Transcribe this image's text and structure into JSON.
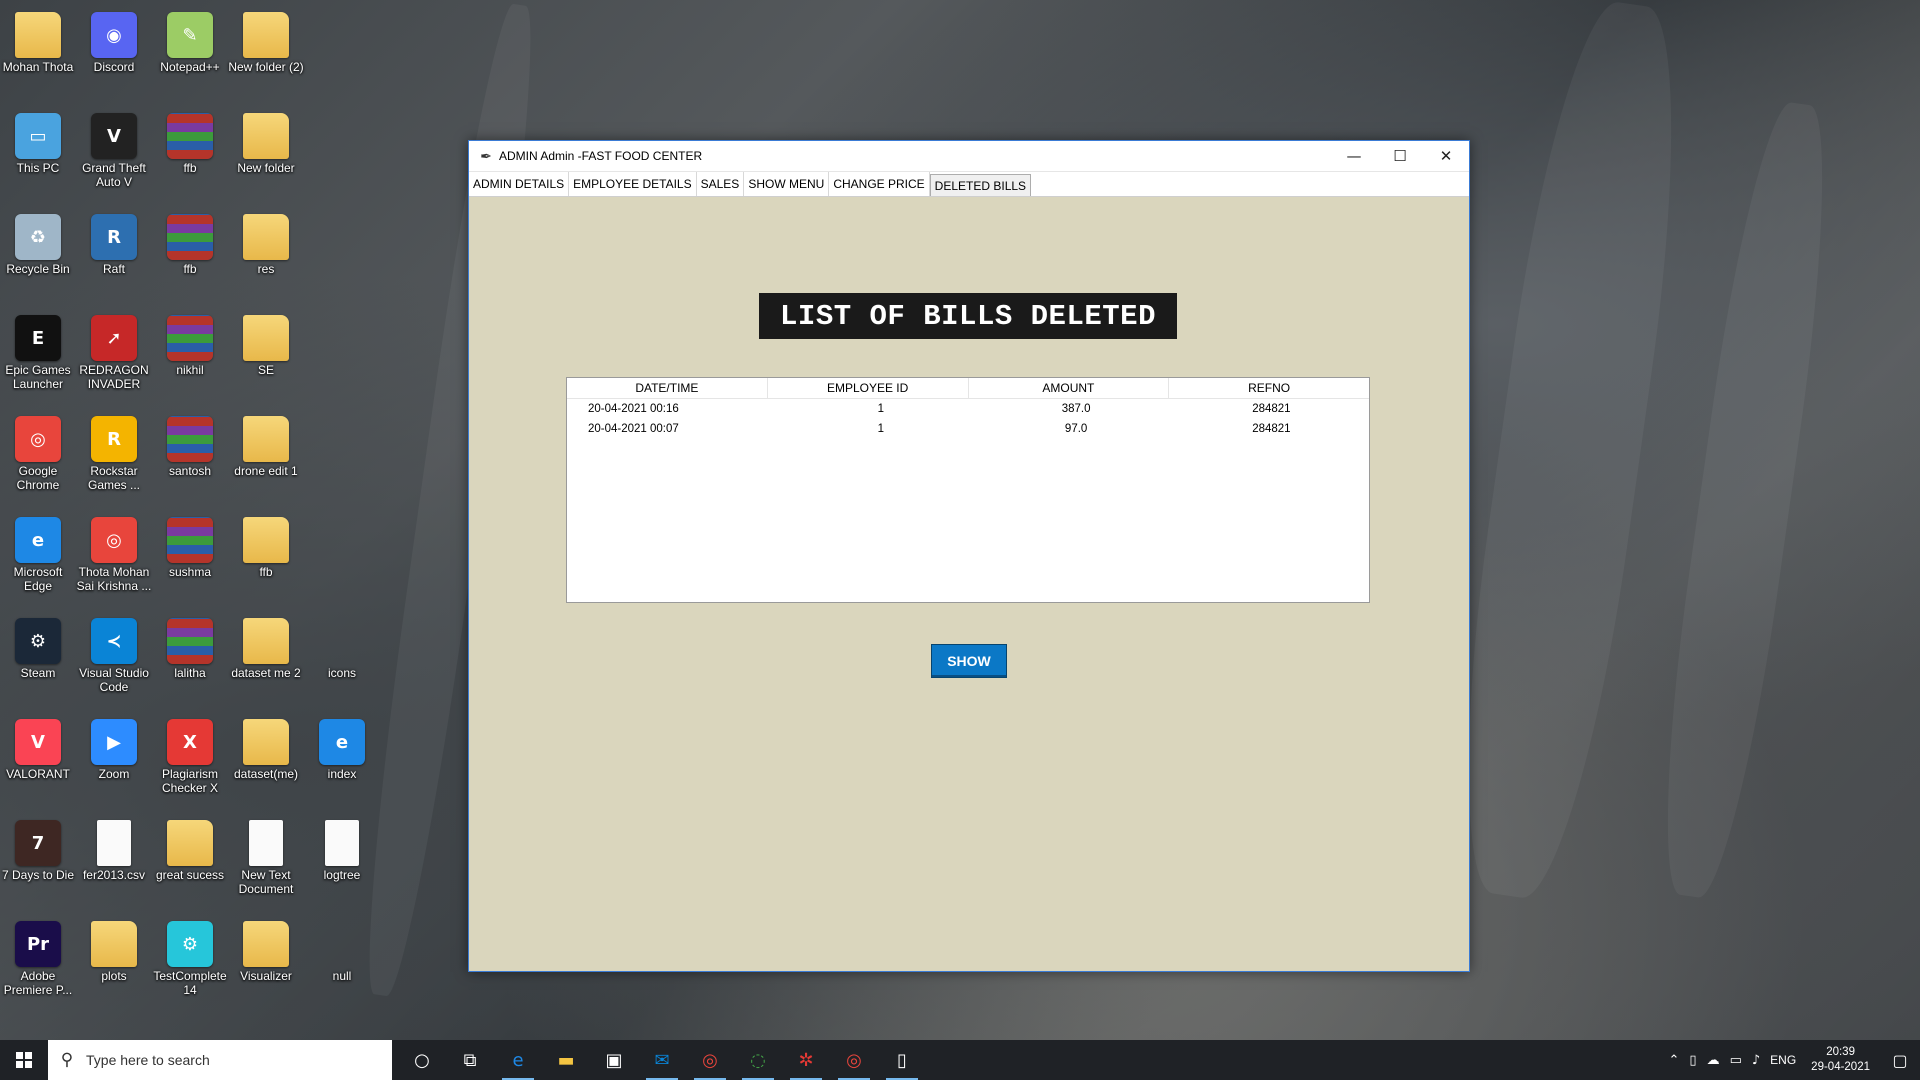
{
  "desktop_icons": [
    {
      "label": "Mohan Thota",
      "kind": "folder"
    },
    {
      "label": "Discord",
      "kind": "app",
      "color": "#5865f2",
      "glyph": "◉"
    },
    {
      "label": "Notepad++",
      "kind": "app",
      "color": "#9ccc65",
      "glyph": "✎"
    },
    {
      "label": "New folder (2)",
      "kind": "folder"
    },
    {
      "label": "This PC",
      "kind": "app",
      "color": "#4aa3df",
      "glyph": "▭"
    },
    {
      "label": "Grand Theft Auto V",
      "kind": "app",
      "color": "#222222",
      "glyph": "V"
    },
    {
      "label": "ffb",
      "kind": "rar"
    },
    {
      "label": "New folder",
      "kind": "folder"
    },
    {
      "label": "Recycle Bin",
      "kind": "app",
      "color": "#9fb6c8",
      "glyph": "♻"
    },
    {
      "label": "Raft",
      "kind": "app",
      "color": "#2d6fb0",
      "glyph": "R"
    },
    {
      "label": "ffb",
      "kind": "rar"
    },
    {
      "label": "res",
      "kind": "folder"
    },
    {
      "label": "Epic Games Launcher",
      "kind": "app",
      "color": "#111111",
      "glyph": "E"
    },
    {
      "label": "REDRAGON INVADER",
      "kind": "app",
      "color": "#c62828",
      "glyph": "➚"
    },
    {
      "label": "nikhil",
      "kind": "rar"
    },
    {
      "label": "SE",
      "kind": "folder"
    },
    {
      "label": "Google Chrome",
      "kind": "app",
      "color": "#e8453c",
      "glyph": "◎"
    },
    {
      "label": "Rockstar Games ...",
      "kind": "app",
      "color": "#f4b400",
      "glyph": "R"
    },
    {
      "label": "santosh",
      "kind": "rar"
    },
    {
      "label": "drone edit 1",
      "kind": "folder"
    },
    {
      "label": "Microsoft Edge",
      "kind": "app",
      "color": "#1e88e5",
      "glyph": "e"
    },
    {
      "label": "Thota Mohan Sai Krishna ...",
      "kind": "app",
      "color": "#e8453c",
      "glyph": "◎"
    },
    {
      "label": "sushma",
      "kind": "rar"
    },
    {
      "label": "ffb",
      "kind": "folder"
    },
    {
      "label": "Steam",
      "kind": "app",
      "color": "#1b2838",
      "glyph": "⚙"
    },
    {
      "label": "Visual Studio Code",
      "kind": "app",
      "color": "#0a84d6",
      "glyph": "≺"
    },
    {
      "label": "lalitha",
      "kind": "rar"
    },
    {
      "label": "dataset me 2",
      "kind": "folder"
    },
    {
      "label": "icons",
      "kind": "none"
    },
    {
      "label": "VALORANT",
      "kind": "app",
      "color": "#fa4454",
      "glyph": "V"
    },
    {
      "label": "Zoom",
      "kind": "app",
      "color": "#2d8cff",
      "glyph": "▶"
    },
    {
      "label": "Plagiarism Checker X",
      "kind": "app",
      "color": "#e53935",
      "glyph": "X"
    },
    {
      "label": "dataset(me)",
      "kind": "folder"
    },
    {
      "label": "index",
      "kind": "app",
      "color": "#1e88e5",
      "glyph": "e"
    },
    {
      "label": "7 Days to Die",
      "kind": "app",
      "color": "#3e2723",
      "glyph": "7"
    },
    {
      "label": "fer2013.csv",
      "kind": "file"
    },
    {
      "label": "great sucess",
      "kind": "folder"
    },
    {
      "label": "New Text Document",
      "kind": "file"
    },
    {
      "label": "logtree",
      "kind": "file"
    },
    {
      "label": "Adobe Premiere P...",
      "kind": "app",
      "color": "#1a0d4a",
      "glyph": "Pr"
    },
    {
      "label": "plots",
      "kind": "folder"
    },
    {
      "label": "TestComplete 14",
      "kind": "app",
      "color": "#26c6da",
      "glyph": "⚙"
    },
    {
      "label": "Visualizer",
      "kind": "folder"
    },
    {
      "label": "null",
      "kind": "none"
    }
  ],
  "window": {
    "title": "ADMIN Admin -FAST FOOD CENTER",
    "controls": {
      "minimize": "—",
      "maximize": "☐",
      "close": "✕"
    },
    "tabs": [
      {
        "label": "ADMIN DETAILS",
        "active": false
      },
      {
        "label": "EMPLOYEE DETAILS",
        "active": false
      },
      {
        "label": "SALES",
        "active": false
      },
      {
        "label": "SHOW MENU",
        "active": false
      },
      {
        "label": "CHANGE PRICE",
        "active": false
      },
      {
        "label": "DELETED BILLS",
        "active": true
      }
    ],
    "heading": "LIST OF BILLS DELETED",
    "table": {
      "columns": [
        "DATE/TIME",
        "EMPLOYEE ID",
        "AMOUNT",
        "REFNO"
      ],
      "rows": [
        [
          "20-04-2021  00:16",
          "1",
          "387.0",
          "284821"
        ],
        [
          "20-04-2021  00:07",
          "1",
          "97.0",
          "284821"
        ]
      ]
    },
    "show_button": "SHOW",
    "colors": {
      "background": "#dad6bd",
      "heading_bg": "#1a1a1a",
      "button": "#0b78c6"
    }
  },
  "taskbar": {
    "search_placeholder": "Type here to search",
    "pinned": [
      {
        "name": "cortana-icon",
        "glyph": "○",
        "color": ""
      },
      {
        "name": "task-view-icon",
        "glyph": "⧉",
        "color": ""
      },
      {
        "name": "edge-icon",
        "glyph": "e",
        "color": "#1e88e5"
      },
      {
        "name": "file-explorer-icon",
        "glyph": "▬",
        "color": "#f4c542"
      },
      {
        "name": "store-icon",
        "glyph": "▣",
        "color": "#ffffff"
      },
      {
        "name": "mail-icon",
        "glyph": "✉",
        "color": "#0a84d6"
      },
      {
        "name": "chrome-icon",
        "glyph": "◎",
        "color": "#e8453c"
      },
      {
        "name": "spinner-app-icon",
        "glyph": "◌",
        "color": "#43a047"
      },
      {
        "name": "settings-app-icon",
        "glyph": "✲",
        "color": "#e53935"
      },
      {
        "name": "chrome-profile-icon",
        "glyph": "◎",
        "color": "#e8453c"
      },
      {
        "name": "tk-window-icon",
        "glyph": "▯",
        "color": "#ffffff"
      }
    ],
    "tray": {
      "language": "ENG",
      "time": "20:39",
      "date": "29-04-2021"
    }
  }
}
